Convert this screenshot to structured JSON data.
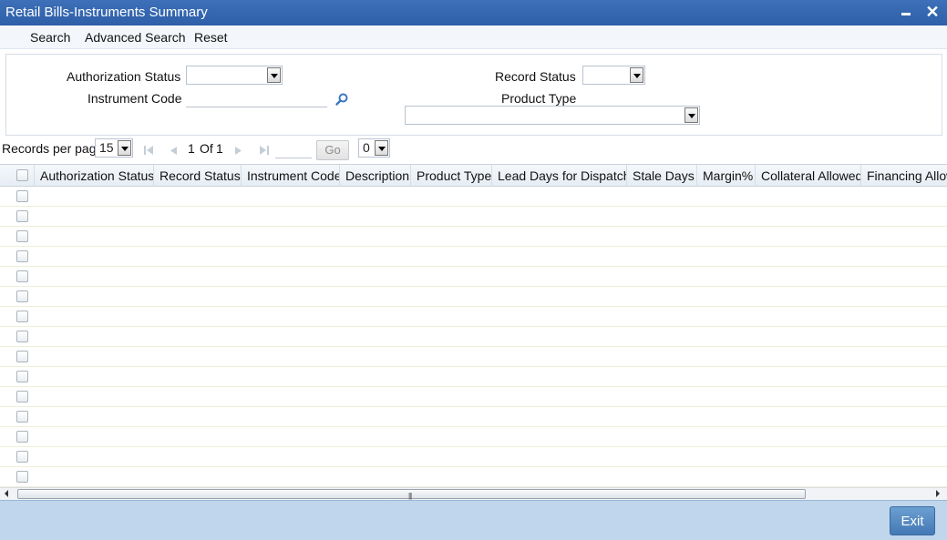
{
  "window": {
    "title": "Retail Bills-Instruments Summary"
  },
  "toolbar": {
    "search": "Search",
    "advanced_search": "Advanced Search",
    "reset": "Reset"
  },
  "form": {
    "authorization_status_label": "Authorization Status",
    "authorization_status_value": "",
    "record_status_label": "Record Status",
    "record_status_value": "",
    "instrument_code_label": "Instrument Code",
    "instrument_code_value": "",
    "product_type_label": "Product Type",
    "product_type_value": ""
  },
  "pager": {
    "records_per_page_label": "Records per page",
    "records_per_page_value": "15",
    "current_page": "1",
    "of_label": "Of",
    "total_pages": "1",
    "go_label": "Go",
    "page_jump_value": "0"
  },
  "grid": {
    "columns": [
      "Authorization Status",
      "Record Status",
      "Instrument Code",
      "Description",
      "Product Type",
      "Lead Days for Dispatch",
      "Stale Days",
      "Margin%",
      "Collateral Allowed",
      "Financing Allow"
    ],
    "rows": [
      [],
      [],
      [],
      [],
      [],
      [],
      [],
      [],
      [],
      [],
      [],
      [],
      [],
      [],
      []
    ]
  },
  "footer": {
    "exit": "Exit"
  },
  "colors": {
    "titlebar": "#2e5fa8",
    "footer": "#bfd6ec",
    "exit_button": "#4f85bf"
  },
  "icons": {
    "lookup": "search-icon",
    "first": "first-page-icon",
    "prev": "prev-page-icon",
    "next": "next-page-icon",
    "last": "last-page-icon"
  }
}
